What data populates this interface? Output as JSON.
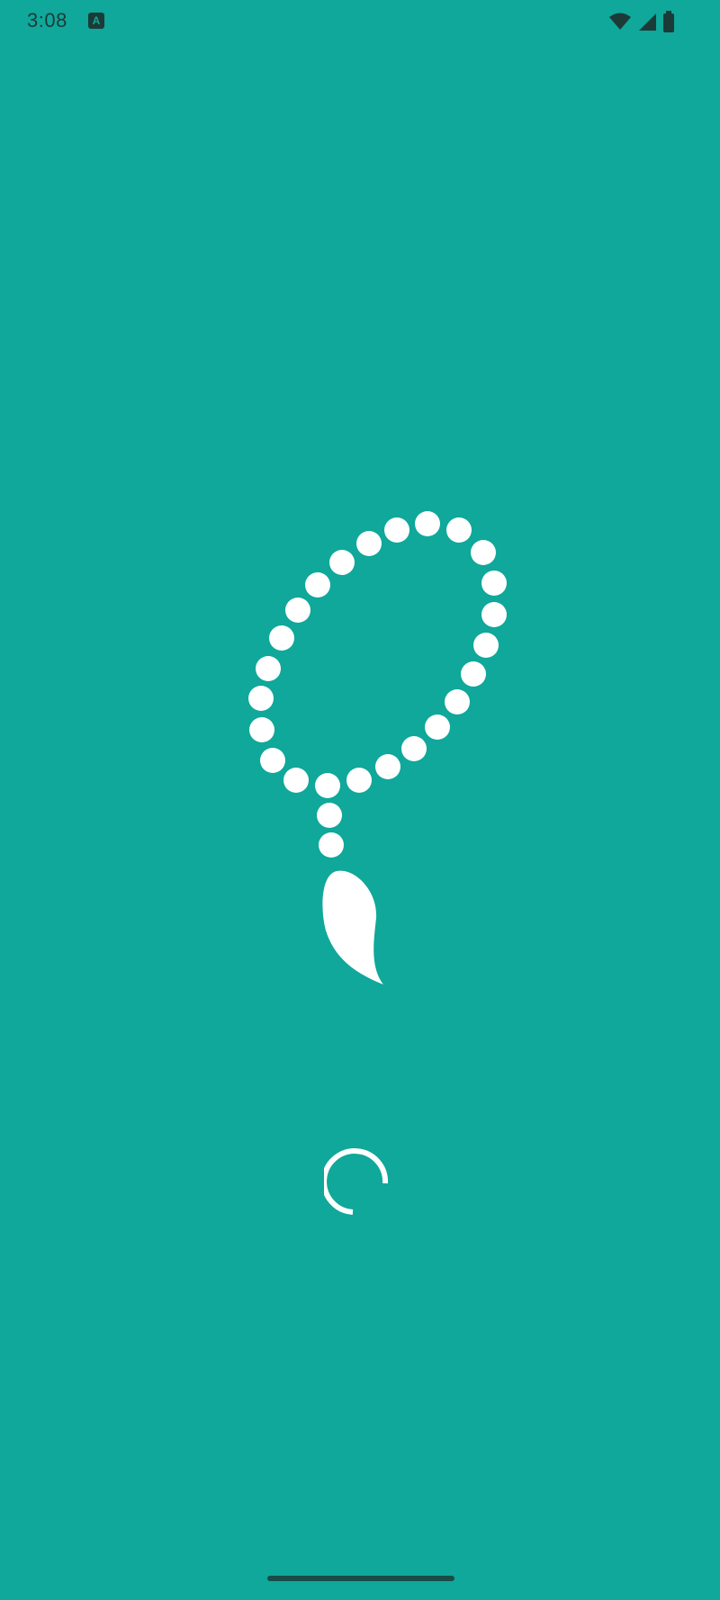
{
  "status_bar": {
    "time": "3:08",
    "notification_icon": "a-icon",
    "icons": [
      "wifi-icon",
      "signal-icon",
      "battery-icon"
    ]
  },
  "splash": {
    "logo_icon": "prayer-beads-icon",
    "loading_indicator": "spinner-icon"
  },
  "colors": {
    "background": "#0fa89a",
    "foreground": "#ffffff",
    "status_text": "#1b3b38"
  }
}
